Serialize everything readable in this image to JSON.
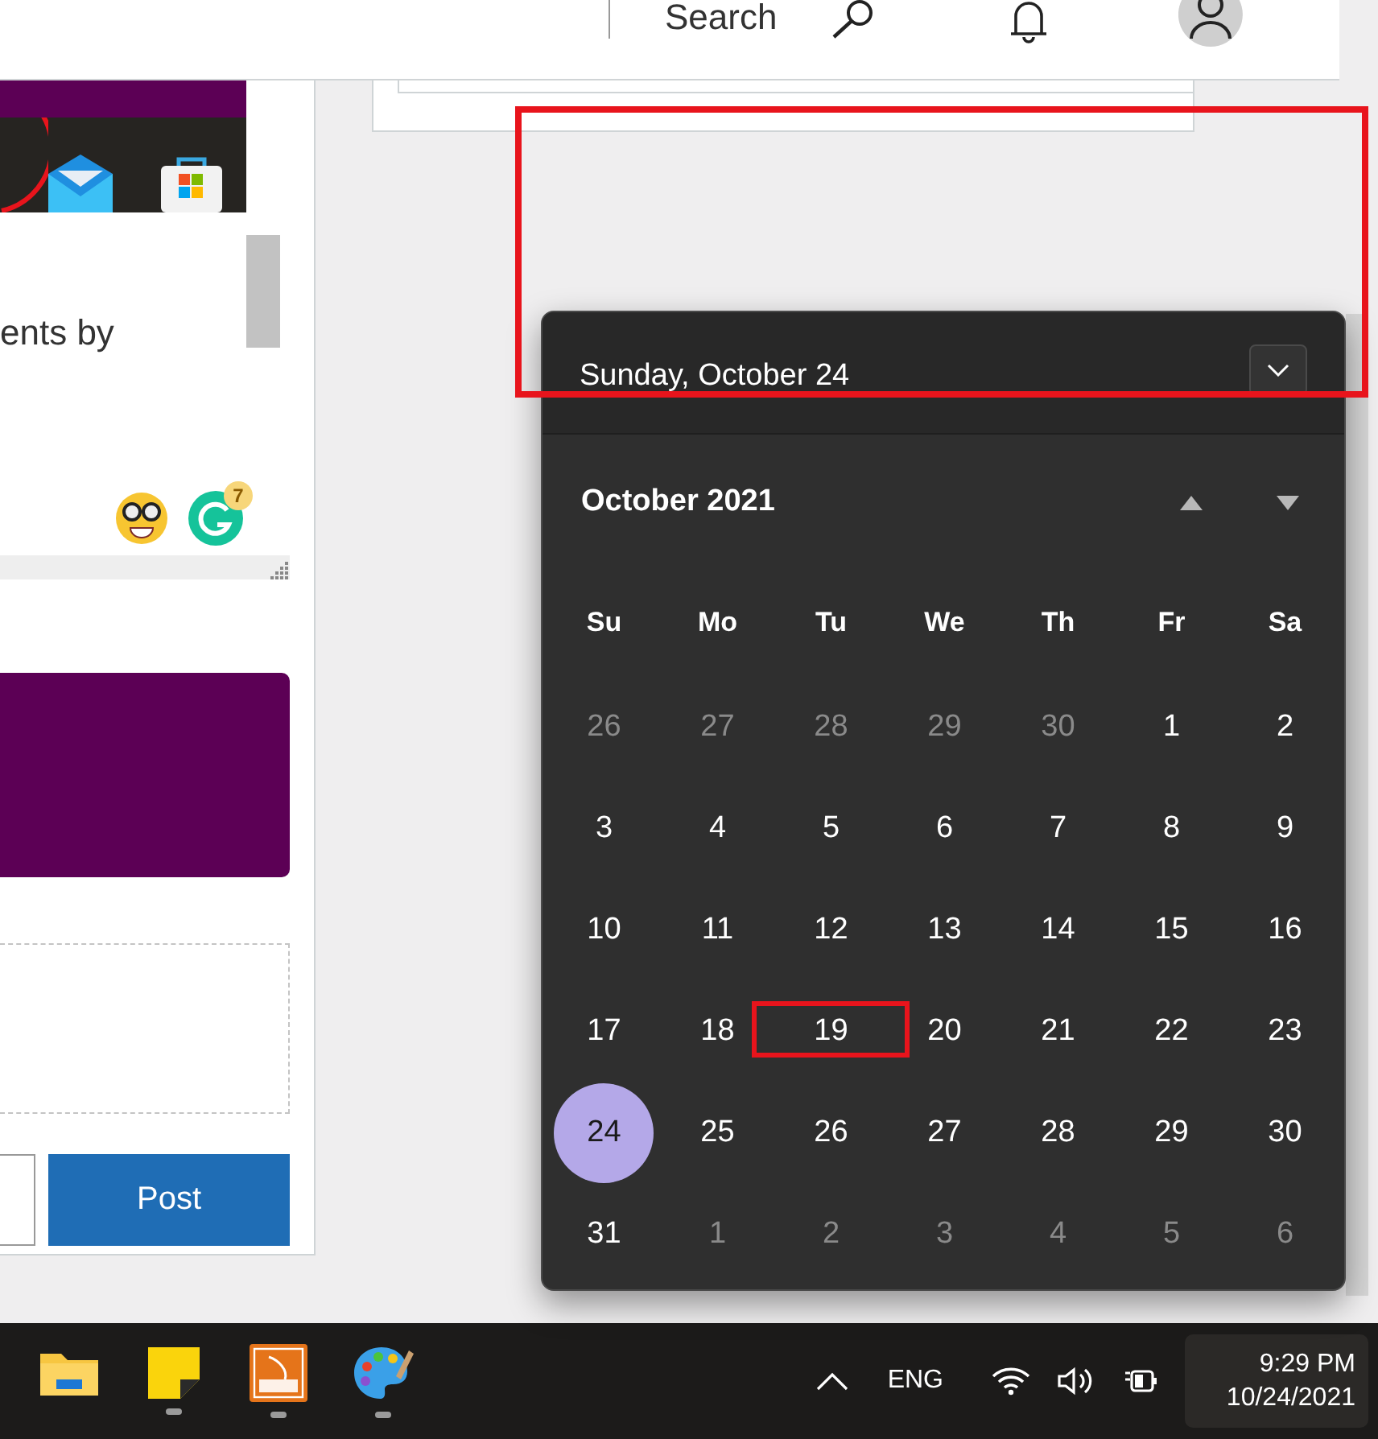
{
  "header": {
    "search_label": "Search"
  },
  "left_panel": {
    "text": "ents by",
    "grammarly_badge": "7",
    "post_button": "Post"
  },
  "calendar": {
    "date_header": "Sunday, October 24",
    "month_title": "October 2021",
    "weekdays": [
      "Su",
      "Mo",
      "Tu",
      "We",
      "Th",
      "Fr",
      "Sa"
    ],
    "days": [
      {
        "label": "26",
        "in_month": false,
        "selected": false,
        "marked": false
      },
      {
        "label": "27",
        "in_month": false,
        "selected": false,
        "marked": false
      },
      {
        "label": "28",
        "in_month": false,
        "selected": false,
        "marked": false
      },
      {
        "label": "29",
        "in_month": false,
        "selected": false,
        "marked": false
      },
      {
        "label": "30",
        "in_month": false,
        "selected": false,
        "marked": false
      },
      {
        "label": "1",
        "in_month": true,
        "selected": false,
        "marked": false
      },
      {
        "label": "2",
        "in_month": true,
        "selected": false,
        "marked": false
      },
      {
        "label": "3",
        "in_month": true,
        "selected": false,
        "marked": false
      },
      {
        "label": "4",
        "in_month": true,
        "selected": false,
        "marked": false
      },
      {
        "label": "5",
        "in_month": true,
        "selected": false,
        "marked": false
      },
      {
        "label": "6",
        "in_month": true,
        "selected": false,
        "marked": false
      },
      {
        "label": "7",
        "in_month": true,
        "selected": false,
        "marked": false
      },
      {
        "label": "8",
        "in_month": true,
        "selected": false,
        "marked": false
      },
      {
        "label": "9",
        "in_month": true,
        "selected": false,
        "marked": false
      },
      {
        "label": "10",
        "in_month": true,
        "selected": false,
        "marked": false
      },
      {
        "label": "11",
        "in_month": true,
        "selected": false,
        "marked": false
      },
      {
        "label": "12",
        "in_month": true,
        "selected": false,
        "marked": false
      },
      {
        "label": "13",
        "in_month": true,
        "selected": false,
        "marked": false
      },
      {
        "label": "14",
        "in_month": true,
        "selected": false,
        "marked": false
      },
      {
        "label": "15",
        "in_month": true,
        "selected": false,
        "marked": false
      },
      {
        "label": "16",
        "in_month": true,
        "selected": false,
        "marked": false
      },
      {
        "label": "17",
        "in_month": true,
        "selected": false,
        "marked": false
      },
      {
        "label": "18",
        "in_month": true,
        "selected": false,
        "marked": false
      },
      {
        "label": "19",
        "in_month": true,
        "selected": false,
        "marked": true
      },
      {
        "label": "20",
        "in_month": true,
        "selected": false,
        "marked": false
      },
      {
        "label": "21",
        "in_month": true,
        "selected": false,
        "marked": false
      },
      {
        "label": "22",
        "in_month": true,
        "selected": false,
        "marked": false
      },
      {
        "label": "23",
        "in_month": true,
        "selected": false,
        "marked": false
      },
      {
        "label": "24",
        "in_month": true,
        "selected": true,
        "marked": false
      },
      {
        "label": "25",
        "in_month": true,
        "selected": false,
        "marked": false
      },
      {
        "label": "26",
        "in_month": true,
        "selected": false,
        "marked": false
      },
      {
        "label": "27",
        "in_month": true,
        "selected": false,
        "marked": false
      },
      {
        "label": "28",
        "in_month": true,
        "selected": false,
        "marked": false
      },
      {
        "label": "29",
        "in_month": true,
        "selected": false,
        "marked": false
      },
      {
        "label": "30",
        "in_month": true,
        "selected": false,
        "marked": false
      },
      {
        "label": "31",
        "in_month": true,
        "selected": false,
        "marked": false
      },
      {
        "label": "1",
        "in_month": false,
        "selected": false,
        "marked": false
      },
      {
        "label": "2",
        "in_month": false,
        "selected": false,
        "marked": false
      },
      {
        "label": "3",
        "in_month": false,
        "selected": false,
        "marked": false
      },
      {
        "label": "4",
        "in_month": false,
        "selected": false,
        "marked": false
      },
      {
        "label": "5",
        "in_month": false,
        "selected": false,
        "marked": false
      },
      {
        "label": "6",
        "in_month": false,
        "selected": false,
        "marked": false
      }
    ]
  },
  "taskbar": {
    "apps": [
      {
        "kind": "folder",
        "running": false
      },
      {
        "kind": "sticky-notes",
        "running": true
      },
      {
        "kind": "pdf",
        "running": true
      },
      {
        "kind": "palette",
        "running": true
      }
    ],
    "language": "ENG",
    "time": "9:29 PM",
    "date": "10/24/2021"
  }
}
